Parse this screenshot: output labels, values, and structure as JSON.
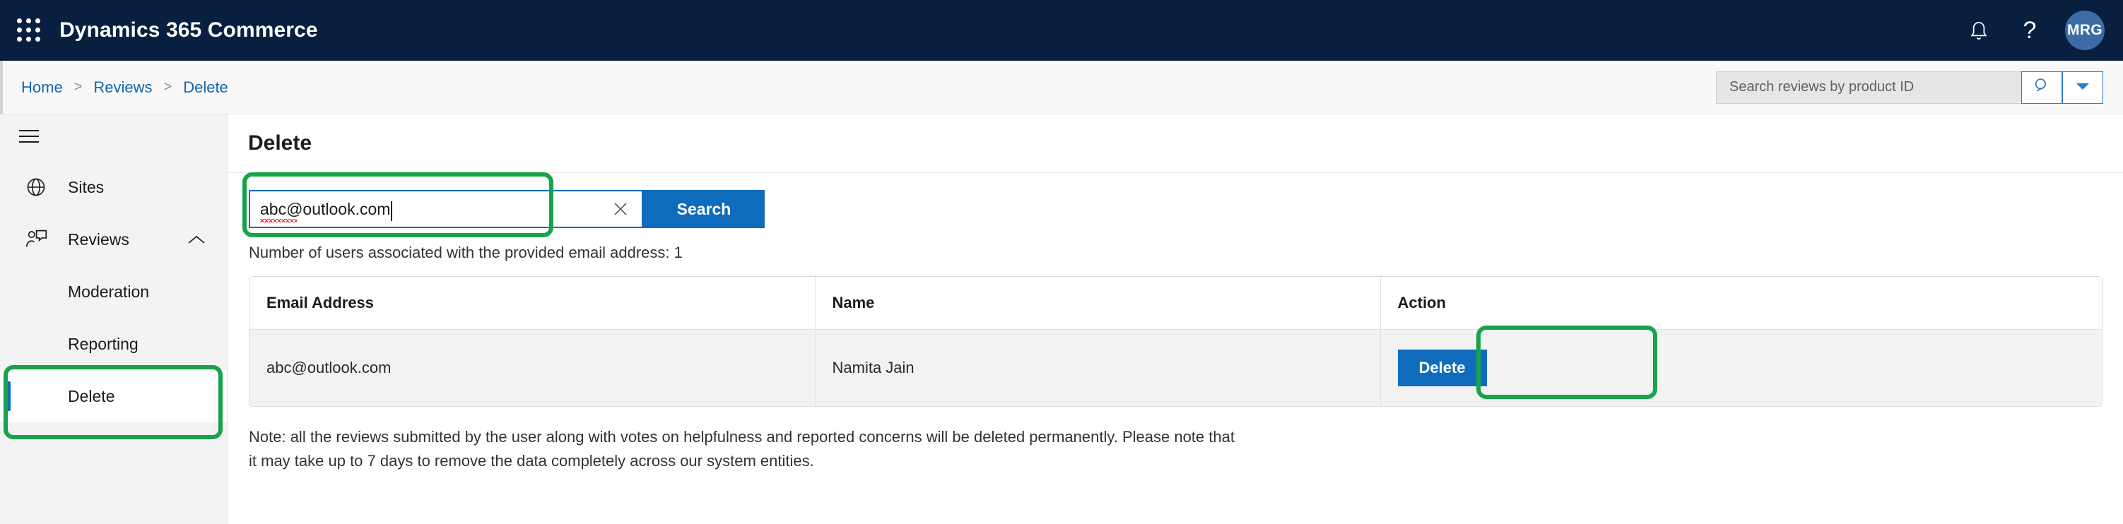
{
  "suite": {
    "app_title": "Dynamics 365 Commerce",
    "waffle_icon": "app-launcher-waffle-icon",
    "notifications_icon": "bell-icon",
    "help_icon": "question-mark-icon",
    "help_glyph": "?",
    "avatar_initials": "MRG",
    "bar_color": "#081f3f",
    "avatar_color": "#3c6ba5"
  },
  "breadcrumb": {
    "items": [
      {
        "label": "Home"
      },
      {
        "label": "Reviews"
      },
      {
        "label": "Delete"
      }
    ],
    "separator": ">",
    "link_color": "#1565ae"
  },
  "top_search": {
    "value": "",
    "placeholder": "Search reviews by product ID",
    "search_icon": "magnifier-icon",
    "dropdown_icon": "chevron-down-icon"
  },
  "sidebar": {
    "hamburger_icon": "hamburger-menu-icon",
    "items": [
      {
        "label": "Sites",
        "icon": "globe-icon",
        "level": "top",
        "active": false
      },
      {
        "label": "Reviews",
        "icon": "person-review-icon",
        "level": "top",
        "active": false,
        "chevron": "chevron-up-icon"
      },
      {
        "label": "Moderation",
        "icon": "",
        "level": "sub",
        "active": false
      },
      {
        "label": "Reporting",
        "icon": "",
        "level": "sub",
        "active": false
      },
      {
        "label": "Delete",
        "icon": "",
        "level": "sub",
        "active": true
      }
    ]
  },
  "main": {
    "page_title": "Delete",
    "email_search": {
      "value": "abc@outlook.com",
      "clear_icon": "clear-x-icon",
      "search_button_label": "Search",
      "button_color": "#0f6cbd"
    },
    "result_count_text": "Number of users associated with the provided email address: 1",
    "table": {
      "columns": [
        "Email Address",
        "Name",
        "Action"
      ],
      "rows": [
        {
          "email": "abc@outlook.com",
          "name": "Namita Jain",
          "action_label": "Delete"
        }
      ]
    },
    "note": "Note: all the reviews submitted by the user along with votes on helpfulness and reported concerns will be deleted permanently. Please note that it may take up to 7 days to remove the data completely across our system entities."
  },
  "annotations": {
    "highlight_color": "#16a34a",
    "boxes": [
      "email-search-highlight",
      "row-delete-button-highlight",
      "sidebar-delete-highlight"
    ]
  }
}
